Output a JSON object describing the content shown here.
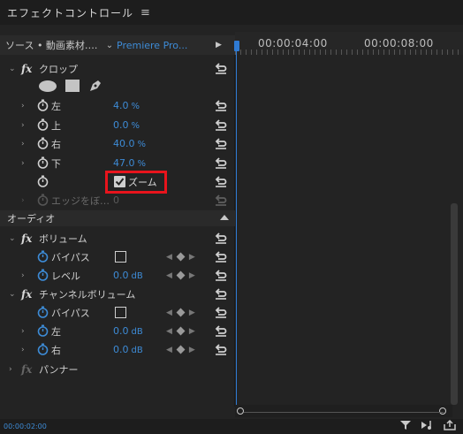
{
  "panel": {
    "title": "エフェクトコントロール",
    "menu_icon": "hamburger-menu-icon"
  },
  "source": {
    "label": "ソース • 動画素材….",
    "clip": "Premiere Pro..."
  },
  "timeline": {
    "marks": [
      "00:00:04:00",
      "00:00:08:00"
    ]
  },
  "video_effects": {
    "crop": {
      "name": "クロップ",
      "properties": [
        {
          "name": "左",
          "value": "4.0",
          "unit": "%"
        },
        {
          "name": "上",
          "value": "0.0",
          "unit": "%"
        },
        {
          "name": "右",
          "value": "40.0",
          "unit": "%"
        },
        {
          "name": "下",
          "value": "47.0",
          "unit": "%"
        }
      ],
      "zoom_label": "ズーム",
      "zoom_checked": true,
      "edge_feather": {
        "name": "エッジをぼ…",
        "value": "0"
      }
    }
  },
  "audio": {
    "header": "オーディオ",
    "volume": {
      "name": "ボリューム",
      "bypass": "バイパス",
      "level": {
        "name": "レベル",
        "value": "0.0",
        "unit": "dB"
      }
    },
    "channel_volume": {
      "name": "チャンネルボリューム",
      "bypass": "バイパス",
      "left": {
        "name": "左",
        "value": "0.0",
        "unit": "dB"
      },
      "right": {
        "name": "右",
        "value": "0.0",
        "unit": "dB"
      }
    },
    "panner": {
      "name": "パンナー"
    }
  },
  "status": {
    "timecode": "00:00:02:00"
  },
  "colors": {
    "accent": "#3d8bd6",
    "highlight": "#e8141c",
    "bg": "#232323"
  }
}
